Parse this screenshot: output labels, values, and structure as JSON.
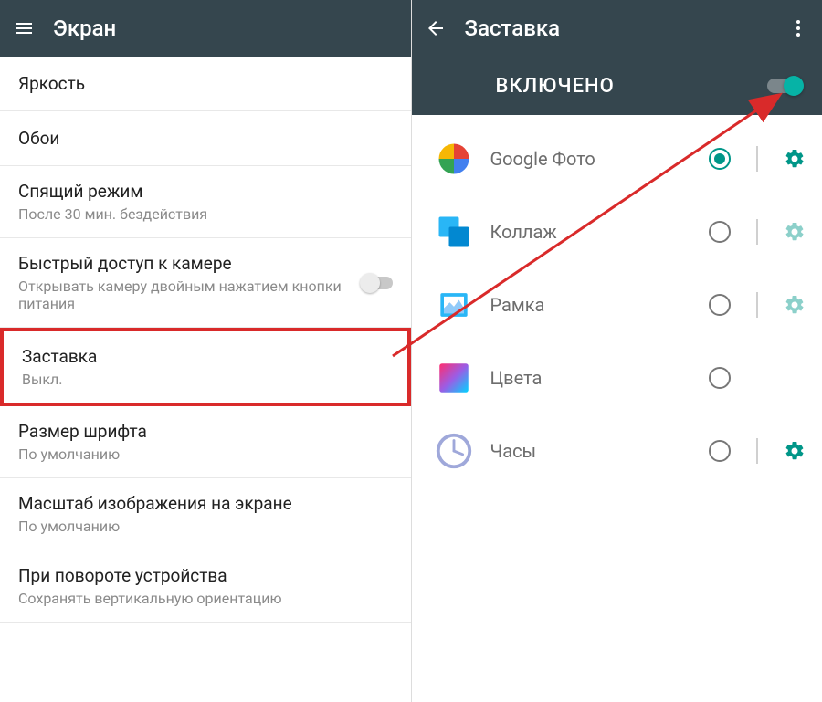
{
  "left": {
    "title": "Экран",
    "items": [
      {
        "title": "Яркость",
        "sub": null,
        "toggle": false
      },
      {
        "title": "Обои",
        "sub": null,
        "toggle": false
      },
      {
        "title": "Спящий режим",
        "sub": "После 30 мин. бездействия",
        "toggle": false
      },
      {
        "title": "Быстрый доступ к камере",
        "sub": "Открывать камеру двойным нажатием кнопки питания",
        "toggle": true
      },
      {
        "title": "Заставка",
        "sub": "Выкл.",
        "toggle": false,
        "highlighted": true
      },
      {
        "title": "Размер шрифта",
        "sub": "По умолчанию",
        "toggle": false
      },
      {
        "title": "Масштаб изображения на экране",
        "sub": "По умолчанию",
        "toggle": false
      },
      {
        "title": "При повороте устройства",
        "sub": "Сохранять вертикальную ориентацию",
        "toggle": false
      }
    ]
  },
  "right": {
    "title": "Заставка",
    "subbar_label": "ВКЛЮЧЕНО",
    "items": [
      {
        "icon": "google-photos",
        "label": "Google Фото",
        "selected": true,
        "gear": "on"
      },
      {
        "icon": "collage",
        "label": "Коллаж",
        "selected": false,
        "gear": "off"
      },
      {
        "icon": "frame",
        "label": "Рамка",
        "selected": false,
        "gear": "off"
      },
      {
        "icon": "colors",
        "label": "Цвета",
        "selected": false,
        "gear": "hidden"
      },
      {
        "icon": "clock",
        "label": "Часы",
        "selected": false,
        "gear": "on"
      }
    ]
  }
}
